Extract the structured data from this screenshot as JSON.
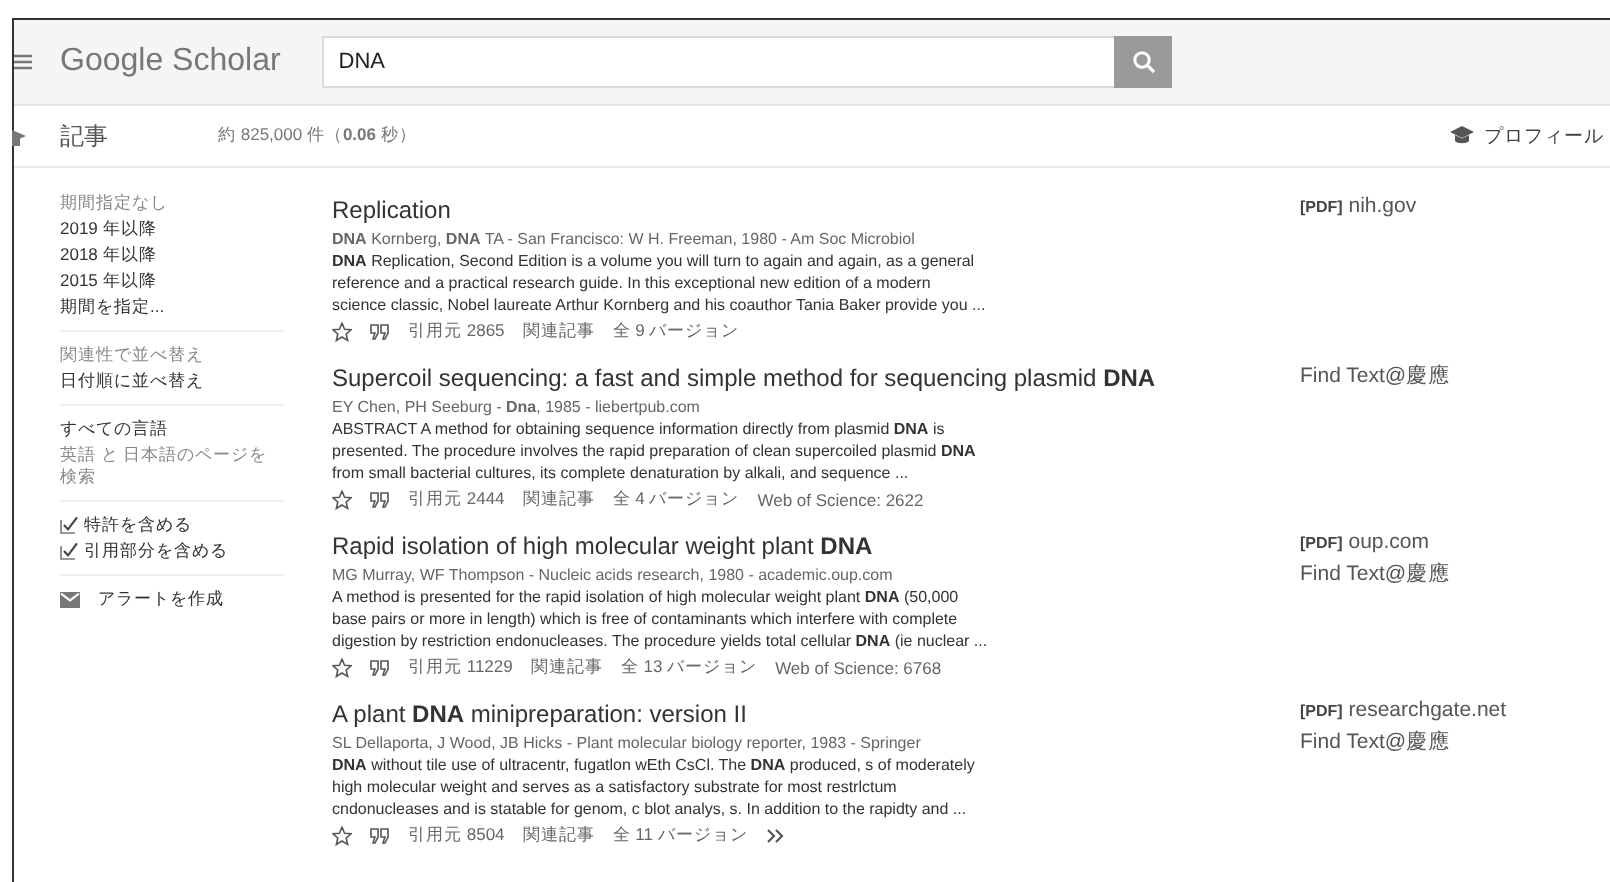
{
  "header": {
    "logo": "Google Scholar",
    "search": {
      "value": "DNA"
    }
  },
  "subbar": {
    "section": "記事",
    "count": "約 825,000 件（**0.06** 秒）",
    "profile": "プロフィール"
  },
  "sidebar": {
    "groups": [
      {
        "kind": "links",
        "items": [
          {
            "label": "期間指定なし",
            "selected": true
          },
          {
            "label": "2019 年以降",
            "selected": false
          },
          {
            "label": "2018 年以降",
            "selected": false
          },
          {
            "label": "2015 年以降",
            "selected": false
          },
          {
            "label": "期間を指定...",
            "selected": false
          }
        ]
      },
      {
        "kind": "links",
        "items": [
          {
            "label": "関連性で並べ替え",
            "selected": true
          },
          {
            "label": "日付順に並べ替え",
            "selected": false
          }
        ]
      },
      {
        "kind": "links",
        "items": [
          {
            "label": "すべての言語",
            "selected": false
          },
          {
            "label": "英語 と 日本語のページを検索",
            "selected": true
          }
        ]
      },
      {
        "kind": "checks",
        "items": [
          {
            "label": "特許を含める",
            "checked": true
          },
          {
            "label": "引用部分を含める",
            "checked": true
          }
        ]
      },
      {
        "kind": "alert",
        "items": [
          {
            "label": "アラートを作成"
          }
        ]
      }
    ]
  },
  "results": [
    {
      "title": "Replication",
      "meta": "**DNA** Kornberg, **DNA** TA - San Francisco: W H. Freeman, 1980 - Am Soc Microbiol",
      "snippet_lines": [
        "**DNA** Replication, Second Edition is a volume you will turn to again and again, as a general",
        "reference and a practical research guide. In this exceptional new edition of a modern",
        "science classic, Nobel laureate Arthur Kornberg and his coauthor Tania Baker provide you ..."
      ],
      "cited": "引用元 2865",
      "related": "関連記事",
      "versions": "全 9 バージョン",
      "links": [
        {
          "tag": "[PDF]",
          "text": "nih.gov"
        }
      ]
    },
    {
      "title": "Supercoil sequencing: a fast and simple method for sequencing plasmid **DNA**",
      "meta": "EY Chen, PH Seeburg - **Dna**, 1985 - liebertpub.com",
      "snippet_lines": [
        "ABSTRACT A method for obtaining sequence information directly from plasmid **DNA** is",
        "presented. The procedure involves the rapid preparation of clean supercoiled plasmid **DNA**",
        "from small bacterial cultures, its complete denaturation by alkali, and sequence ..."
      ],
      "cited": "引用元 2444",
      "related": "関連記事",
      "versions": "全 4 バージョン",
      "wos": "Web of Science: 2622",
      "links": [
        {
          "text": "Find Text@慶應"
        }
      ]
    },
    {
      "title": "Rapid isolation of high molecular weight plant **DNA**",
      "meta": "MG Murray, WF Thompson - Nucleic acids research, 1980 - academic.oup.com",
      "snippet_lines": [
        "A method is presented for the rapid isolation of high molecular weight plant **DNA** (50,000",
        "base pairs or more in length) which is free of contaminants which interfere with complete",
        "digestion by restriction endonucleases. The procedure yields total cellular **DNA** (ie nuclear ..."
      ],
      "cited": "引用元 11229",
      "related": "関連記事",
      "versions": "全 13 バージョン",
      "wos": "Web of Science: 6768",
      "links": [
        {
          "tag": "[PDF]",
          "text": "oup.com"
        },
        {
          "text": "Find Text@慶應"
        }
      ]
    },
    {
      "title": "A plant **DNA** minipreparation: version II",
      "meta": "SL Dellaporta, J Wood, JB Hicks - Plant molecular biology reporter, 1983 - Springer",
      "snippet_lines": [
        "**DNA** without tile use of ultracentr, fugatlon wEth CsCl. The **DNA** produced, s of moderately",
        "high molecular weight and serves as a satisfactory substrate for most restrlctum",
        "cndonucleases and is statable for genom, c blot analys, s. In addition to the rapidty and ..."
      ],
      "cited": "引用元 8504",
      "related": "関連記事",
      "versions": "全 11 バージョン",
      "more": true,
      "links": [
        {
          "tag": "[PDF]",
          "text": "researchgate.net"
        },
        {
          "text": "Find Text@慶應"
        }
      ]
    }
  ]
}
